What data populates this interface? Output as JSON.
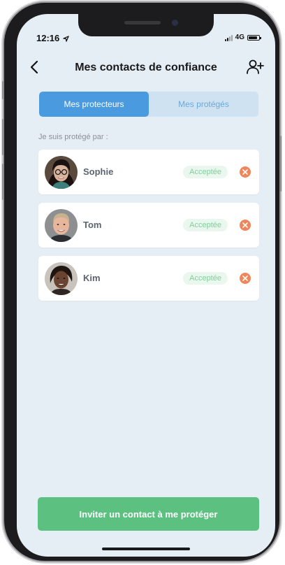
{
  "status_bar": {
    "time": "12:16",
    "network": "4G",
    "battery_level": 0.85
  },
  "header": {
    "title": "Mes contacts de confiance",
    "back_icon": "chevron-left-icon",
    "add_icon": "add-user-icon"
  },
  "tabs": [
    {
      "label": "Mes protecteurs",
      "active": true
    },
    {
      "label": "Mes protégés",
      "active": false
    }
  ],
  "section_label": "Je suis protégé par :",
  "contacts": [
    {
      "name": "Sophie",
      "status": "Acceptée"
    },
    {
      "name": "Tom",
      "status": "Acceptée"
    },
    {
      "name": "Kim",
      "status": "Acceptée"
    }
  ],
  "invite_button": "Inviter un contact à me protéger",
  "colors": {
    "accent": "#4a9ae0",
    "success": "#5cc180",
    "danger": "#ef8558",
    "background": "#e6eef5"
  }
}
